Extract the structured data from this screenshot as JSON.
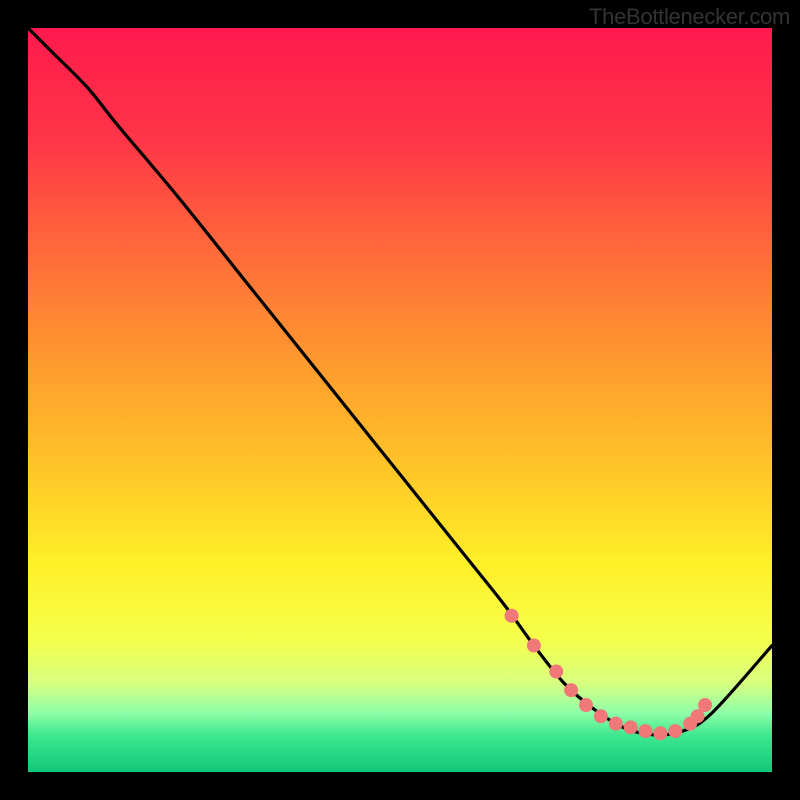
{
  "attribution": "TheBottlenecker.com",
  "chart_data": {
    "type": "line",
    "title": "",
    "xlabel": "",
    "ylabel": "",
    "xlim": [
      0,
      100
    ],
    "ylim": [
      0,
      100
    ],
    "series": [
      {
        "name": "curve",
        "x": [
          0,
          3,
          8,
          12,
          20,
          30,
          40,
          50,
          58,
          64,
          68,
          72,
          76,
          80,
          84,
          88,
          92,
          100
        ],
        "y": [
          100,
          97,
          92,
          87,
          77.5,
          65,
          52.5,
          40,
          30,
          22.5,
          17,
          12,
          8.5,
          6,
          5,
          5.5,
          8,
          17
        ]
      }
    ],
    "markers": {
      "name": "points",
      "color": "#f07878",
      "x": [
        65,
        68,
        71,
        73,
        75,
        77,
        79,
        81,
        83,
        85,
        87,
        89,
        90,
        91
      ],
      "y": [
        21,
        17,
        13.5,
        11,
        9,
        7.5,
        6.5,
        6,
        5.5,
        5.2,
        5.5,
        6.5,
        7.5,
        9
      ]
    },
    "gradient_stops": [
      {
        "offset": 0.0,
        "color": "#ff1a4d"
      },
      {
        "offset": 0.15,
        "color": "#ff3547"
      },
      {
        "offset": 0.3,
        "color": "#ff6a3a"
      },
      {
        "offset": 0.45,
        "color": "#ff9a2e"
      },
      {
        "offset": 0.6,
        "color": "#ffc828"
      },
      {
        "offset": 0.72,
        "color": "#fff028"
      },
      {
        "offset": 0.82,
        "color": "#f5ff4a"
      },
      {
        "offset": 0.88,
        "color": "#d8ff80"
      },
      {
        "offset": 0.92,
        "color": "#90ffa8"
      },
      {
        "offset": 0.95,
        "color": "#40e890"
      },
      {
        "offset": 1.0,
        "color": "#10c878"
      }
    ]
  }
}
